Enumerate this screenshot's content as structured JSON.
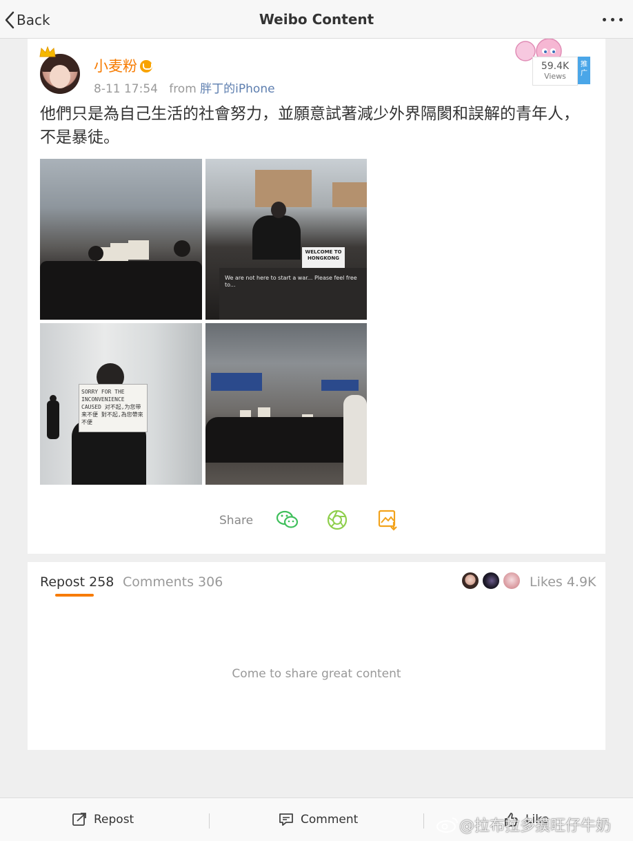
{
  "nav": {
    "back_label": "Back",
    "title": "Weibo Content"
  },
  "post": {
    "username": "小麦粉",
    "time": "8-11 17:54",
    "from_label": "from",
    "source": "胖丁的iPhone",
    "views_count": "59.4K",
    "views_label": "Views",
    "promo_tag": "推广",
    "text": "他們只是為自己生活的社會努力，並願意試著減少外界隔閡和誤解的青年人，不是暴徒。",
    "images": [
      {
        "signs": [
          "WELCOME TO HONGKONG"
        ],
        "board_text": "We are not here to start a war... Please feel free to... "
      },
      {
        "sign_text": "SORRY FOR THE INCONVENIENCE CAUSED 对不起,为您带来不便 對不起,為您帶來不便"
      }
    ],
    "welcome_sign": "WELCOME TO HONGKONG",
    "sorry_sign": "SORRY FOR THE INCONVENIENCE CAUSED 对不起,为您带来不便 對不起,為您帶來不便",
    "share_label": "Share"
  },
  "tabs": {
    "repost_label": "Repost",
    "repost_count": "258",
    "comments_label": "Comments",
    "comments_count": "306",
    "likes_label": "Likes",
    "likes_count": "4.9K",
    "empty_message": "Come to share great content",
    "accent_color": "#f77b00"
  },
  "toolbar": {
    "repost_label": "Repost",
    "comment_label": "Comment",
    "like_label": "Like"
  },
  "watermark": "@拉布拉多摸旺仔牛奶"
}
